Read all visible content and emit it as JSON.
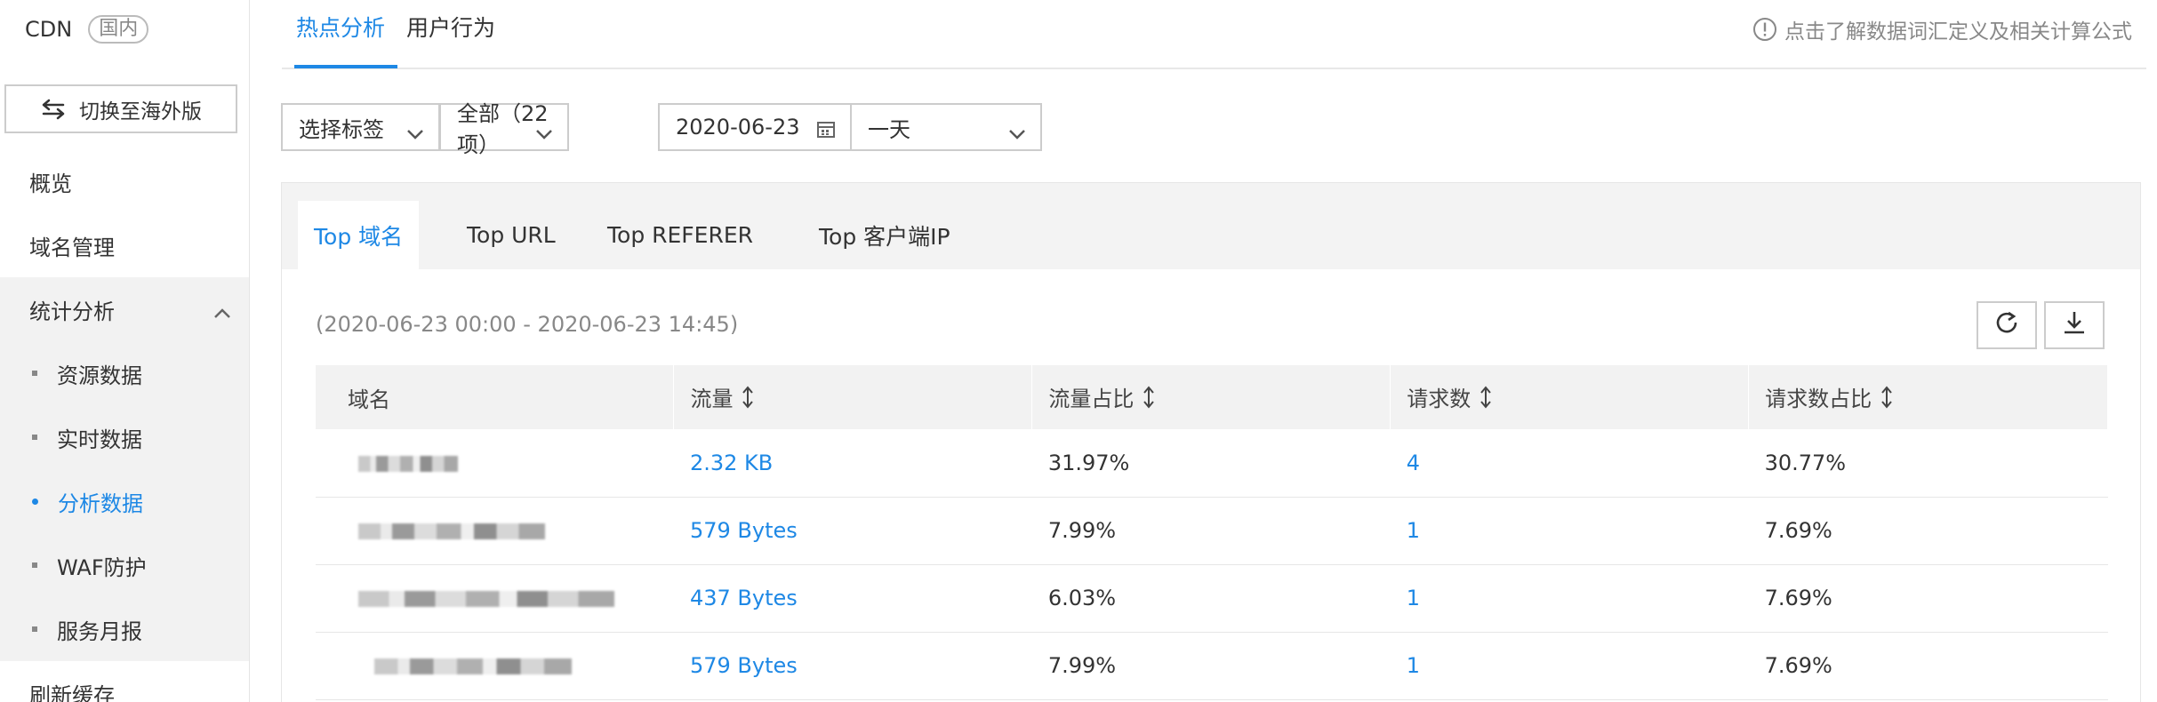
{
  "sidebar": {
    "brand": "CDN",
    "badge": "国内",
    "switch_label": "切换至海外版",
    "items": [
      {
        "label": "概览"
      },
      {
        "label": "域名管理"
      },
      {
        "label": "统计分析"
      },
      {
        "label": "刷新缓存"
      }
    ],
    "sub_items": [
      {
        "label": "资源数据"
      },
      {
        "label": "实时数据"
      },
      {
        "label": "分析数据",
        "active": true
      },
      {
        "label": "WAF防护"
      },
      {
        "label": "服务月报"
      }
    ]
  },
  "top_tabs": [
    {
      "label": "热点分析",
      "active": true
    },
    {
      "label": "用户行为"
    }
  ],
  "help_text": "点击了解数据词汇定义及相关计算公式",
  "filters": {
    "tag_select": "选择标签",
    "scope_select": "全部（22项）",
    "date": "2020-06-23",
    "period_select": "一天"
  },
  "inner_tabs": [
    {
      "label": "Top 域名",
      "active": true
    },
    {
      "label": "Top URL"
    },
    {
      "label": "Top REFERER"
    },
    {
      "label": "Top 客户端IP"
    }
  ],
  "time_range": "(2020-06-23 00:00 - 2020-06-23 14:45)",
  "table": {
    "headers": [
      "域名",
      "流量",
      "流量占比",
      "请求数",
      "请求数占比"
    ],
    "rows": [
      {
        "traffic": "2.32 KB",
        "traffic_pct": "31.97%",
        "requests": "4",
        "requests_pct": "30.77%"
      },
      {
        "traffic": "579 Bytes",
        "traffic_pct": "7.99%",
        "requests": "1",
        "requests_pct": "7.69%"
      },
      {
        "traffic": "437 Bytes",
        "traffic_pct": "6.03%",
        "requests": "1",
        "requests_pct": "7.69%"
      },
      {
        "traffic": "579 Bytes",
        "traffic_pct": "7.99%",
        "requests": "1",
        "requests_pct": "7.69%"
      }
    ]
  },
  "colors": {
    "accent": "#1e88e5",
    "sidebar_group_bg": "#f2f2f2",
    "panel_bg": "#f3f3f3"
  }
}
